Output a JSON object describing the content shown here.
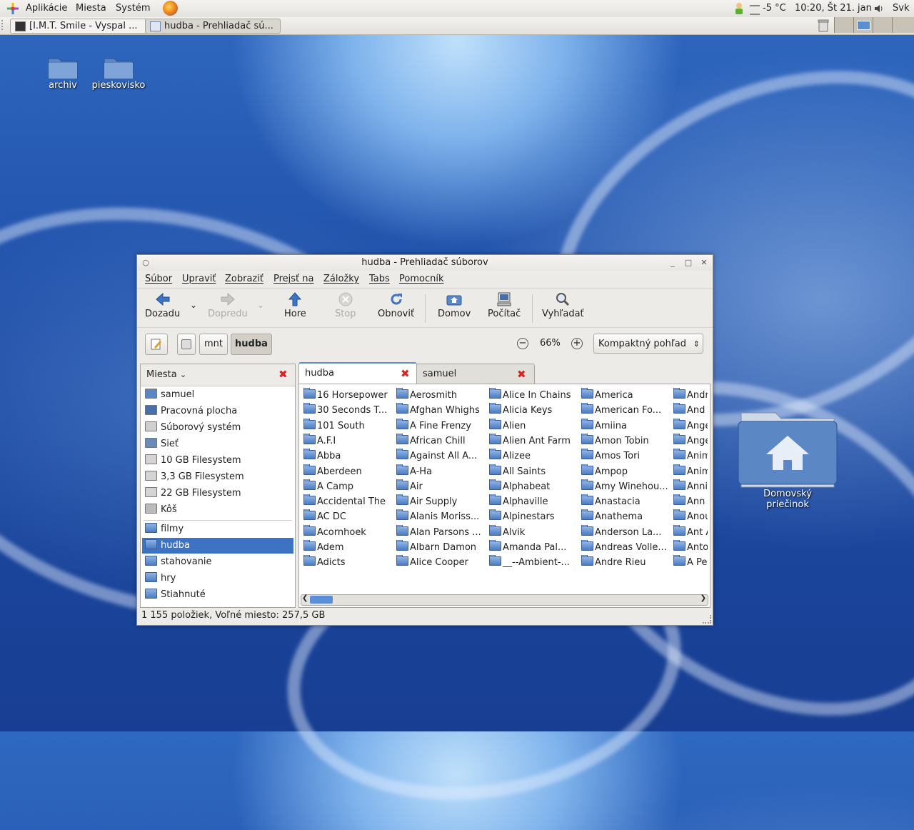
{
  "panel": {
    "menus": [
      "Aplikácie",
      "Miesta",
      "Systém"
    ],
    "weather": "-5 °C",
    "clock": "10:20, Št 21. jan",
    "keyboard": "Svk"
  },
  "taskbar": {
    "tasks": [
      {
        "label": "[I.M.T. Smile - Vyspal ..."
      },
      {
        "label": "hudba - Prehliadač sú..."
      }
    ]
  },
  "desktop": {
    "icons": [
      "archiv",
      "pieskovisko"
    ],
    "home_line1": "Domovský",
    "home_line2": "priečinok"
  },
  "window": {
    "title": "hudba - Prehliadač súborov",
    "menu": [
      "Súbor",
      "Upraviť",
      "Zobraziť",
      "Prejsť na",
      "Záložky",
      "Tabs",
      "Pomocník"
    ],
    "toolbar": {
      "back": "Dozadu",
      "forward": "Dopredu",
      "up": "Hore",
      "stop": "Stop",
      "reload": "Obnoviť",
      "home": "Domov",
      "computer": "Počítač",
      "search": "Vyhľadať"
    },
    "path": [
      "mnt",
      "hudba"
    ],
    "zoom": "66%",
    "view_mode": "Kompaktný pohľad",
    "side": {
      "header": "Miesta",
      "places": [
        "samuel",
        "Pracovná plocha",
        "Súborový systém",
        "Sieť",
        "10 GB Filesystem",
        "3,3 GB Filesystem",
        "22 GB Filesystem",
        "Kôš"
      ],
      "bookmarks": [
        "filmy",
        "hudba",
        "stahovanie",
        "hry",
        "Stiahnuté"
      ]
    },
    "tabs": [
      "hudba",
      "samuel"
    ],
    "files": {
      "col1": [
        "16 Horsepower",
        "30 Seconds T...",
        "101 South",
        "A.F.I",
        "Abba",
        "Aberdeen",
        "A Camp",
        "Accidental The",
        "AC DC",
        "Acornhoek",
        "Adem",
        "Adicts"
      ],
      "col2": [
        "Aerosmith",
        "Afghan Whighs",
        "A Fine Frenzy",
        "African Chill",
        "Against All A...",
        "A-Ha",
        "Air",
        "Air Supply",
        "Alanis Moriss...",
        "Alan Parsons ...",
        "Albarn Damon",
        "Alice Cooper"
      ],
      "col3": [
        "Alice In Chains",
        "Alicia Keys",
        "Alien",
        "Alien Ant Farm",
        "Alizee",
        "All Saints",
        "Alphabeat",
        "Alphaville",
        "Alpinestars",
        "Alvik",
        "Amanda Pal...",
        "__--Ambient-..."
      ],
      "col4": [
        "America",
        "American Fo...",
        "Amiina",
        "Amon Tobin",
        "Amos Tori",
        "Ampop",
        "Amy Winehou...",
        "Anastacia",
        "Anathema",
        "Anderson La...",
        "Andreas Volle...",
        "Andre Rieu"
      ],
      "col5": [
        "Andr",
        "And y",
        "Ange",
        "Ange",
        "Anim",
        "Anim",
        "Annie",
        "Ann",
        "Anou",
        "Ant A",
        "Anto",
        "A Pe"
      ]
    },
    "status": "1 155 položiek, Voľné miesto: 257,5 GB"
  }
}
